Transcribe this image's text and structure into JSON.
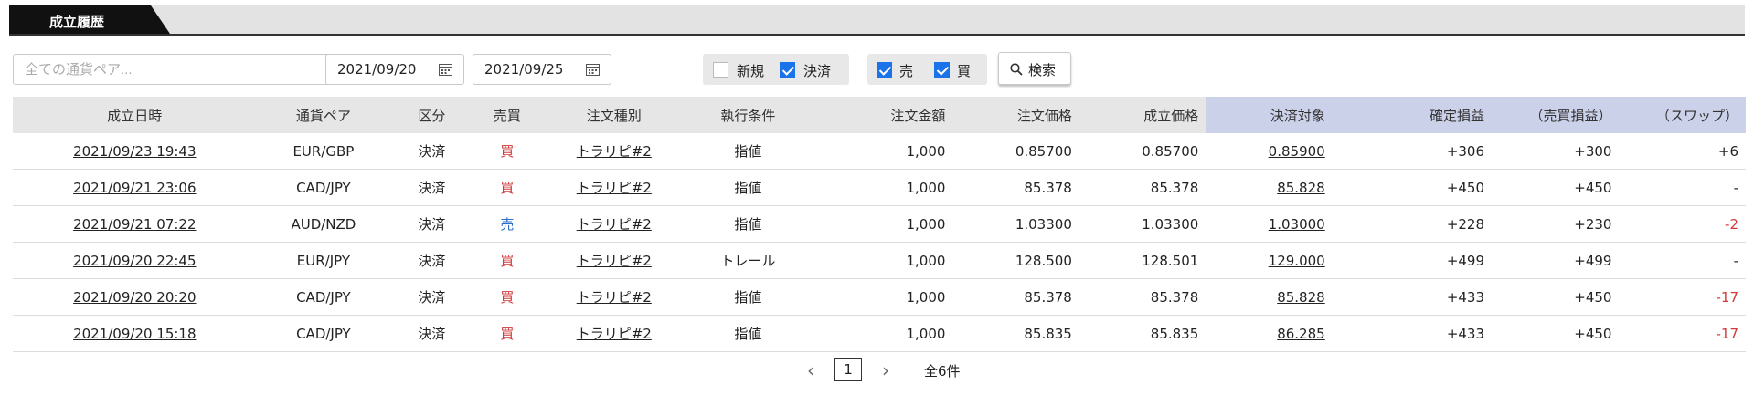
{
  "tab": {
    "label": "成立履歴"
  },
  "toolbar": {
    "search_placeholder": "全ての通貨ペア...",
    "date_from": "2021/09/20",
    "date_to": "2021/09/25",
    "filter_new": {
      "label": "新規",
      "checked": false
    },
    "filter_settle": {
      "label": "決済",
      "checked": true
    },
    "filter_sell": {
      "label": "売",
      "checked": true
    },
    "filter_buy": {
      "label": "買",
      "checked": true
    },
    "search_button": "検索"
  },
  "table": {
    "headers": [
      "成立日時",
      "通貨ペア",
      "区分",
      "売買",
      "注文種別",
      "執行条件",
      "注文金額",
      "注文価格",
      "成立価格",
      "決済対象",
      "確定損益",
      "（売買損益）",
      "（スワップ）"
    ],
    "rows": [
      {
        "datetime": "2021/09/23 19:43",
        "pair": "EUR/GBP",
        "kind": "決済",
        "side": "買",
        "order_type": "トラリピ#2",
        "condition": "指値",
        "amount": "1,000",
        "order_price": "0.85700",
        "fill_price": "0.85700",
        "target": "0.85900",
        "pnl": "+306",
        "trade_pnl": "+300",
        "swap": "+6"
      },
      {
        "datetime": "2021/09/21 23:06",
        "pair": "CAD/JPY",
        "kind": "決済",
        "side": "買",
        "order_type": "トラリピ#2",
        "condition": "指値",
        "amount": "1,000",
        "order_price": "85.378",
        "fill_price": "85.378",
        "target": "85.828",
        "pnl": "+450",
        "trade_pnl": "+450",
        "swap": "-"
      },
      {
        "datetime": "2021/09/21 07:22",
        "pair": "AUD/NZD",
        "kind": "決済",
        "side": "売",
        "order_type": "トラリピ#2",
        "condition": "指値",
        "amount": "1,000",
        "order_price": "1.03300",
        "fill_price": "1.03300",
        "target": "1.03000",
        "pnl": "+228",
        "trade_pnl": "+230",
        "swap": "-2"
      },
      {
        "datetime": "2021/09/20 22:45",
        "pair": "EUR/JPY",
        "kind": "決済",
        "side": "買",
        "order_type": "トラリピ#2",
        "condition": "トレール",
        "amount": "1,000",
        "order_price": "128.500",
        "fill_price": "128.501",
        "target": "129.000",
        "pnl": "+499",
        "trade_pnl": "+499",
        "swap": "-"
      },
      {
        "datetime": "2021/09/20 20:20",
        "pair": "CAD/JPY",
        "kind": "決済",
        "side": "買",
        "order_type": "トラリピ#2",
        "condition": "指値",
        "amount": "1,000",
        "order_price": "85.378",
        "fill_price": "85.378",
        "target": "85.828",
        "pnl": "+433",
        "trade_pnl": "+450",
        "swap": "-17"
      },
      {
        "datetime": "2021/09/20 15:18",
        "pair": "CAD/JPY",
        "kind": "決済",
        "side": "買",
        "order_type": "トラリピ#2",
        "condition": "指値",
        "amount": "1,000",
        "order_price": "85.835",
        "fill_price": "85.835",
        "target": "86.285",
        "pnl": "+433",
        "trade_pnl": "+450",
        "swap": "-17"
      }
    ]
  },
  "pagination": {
    "current": "1",
    "total_label": "全6件"
  },
  "colors": {
    "buy": "#d03a3a",
    "sell": "#2a6fc9",
    "negative": "#d03a3a",
    "checkbox": "#1a73e8",
    "header_highlight": "#ccd1ea"
  }
}
